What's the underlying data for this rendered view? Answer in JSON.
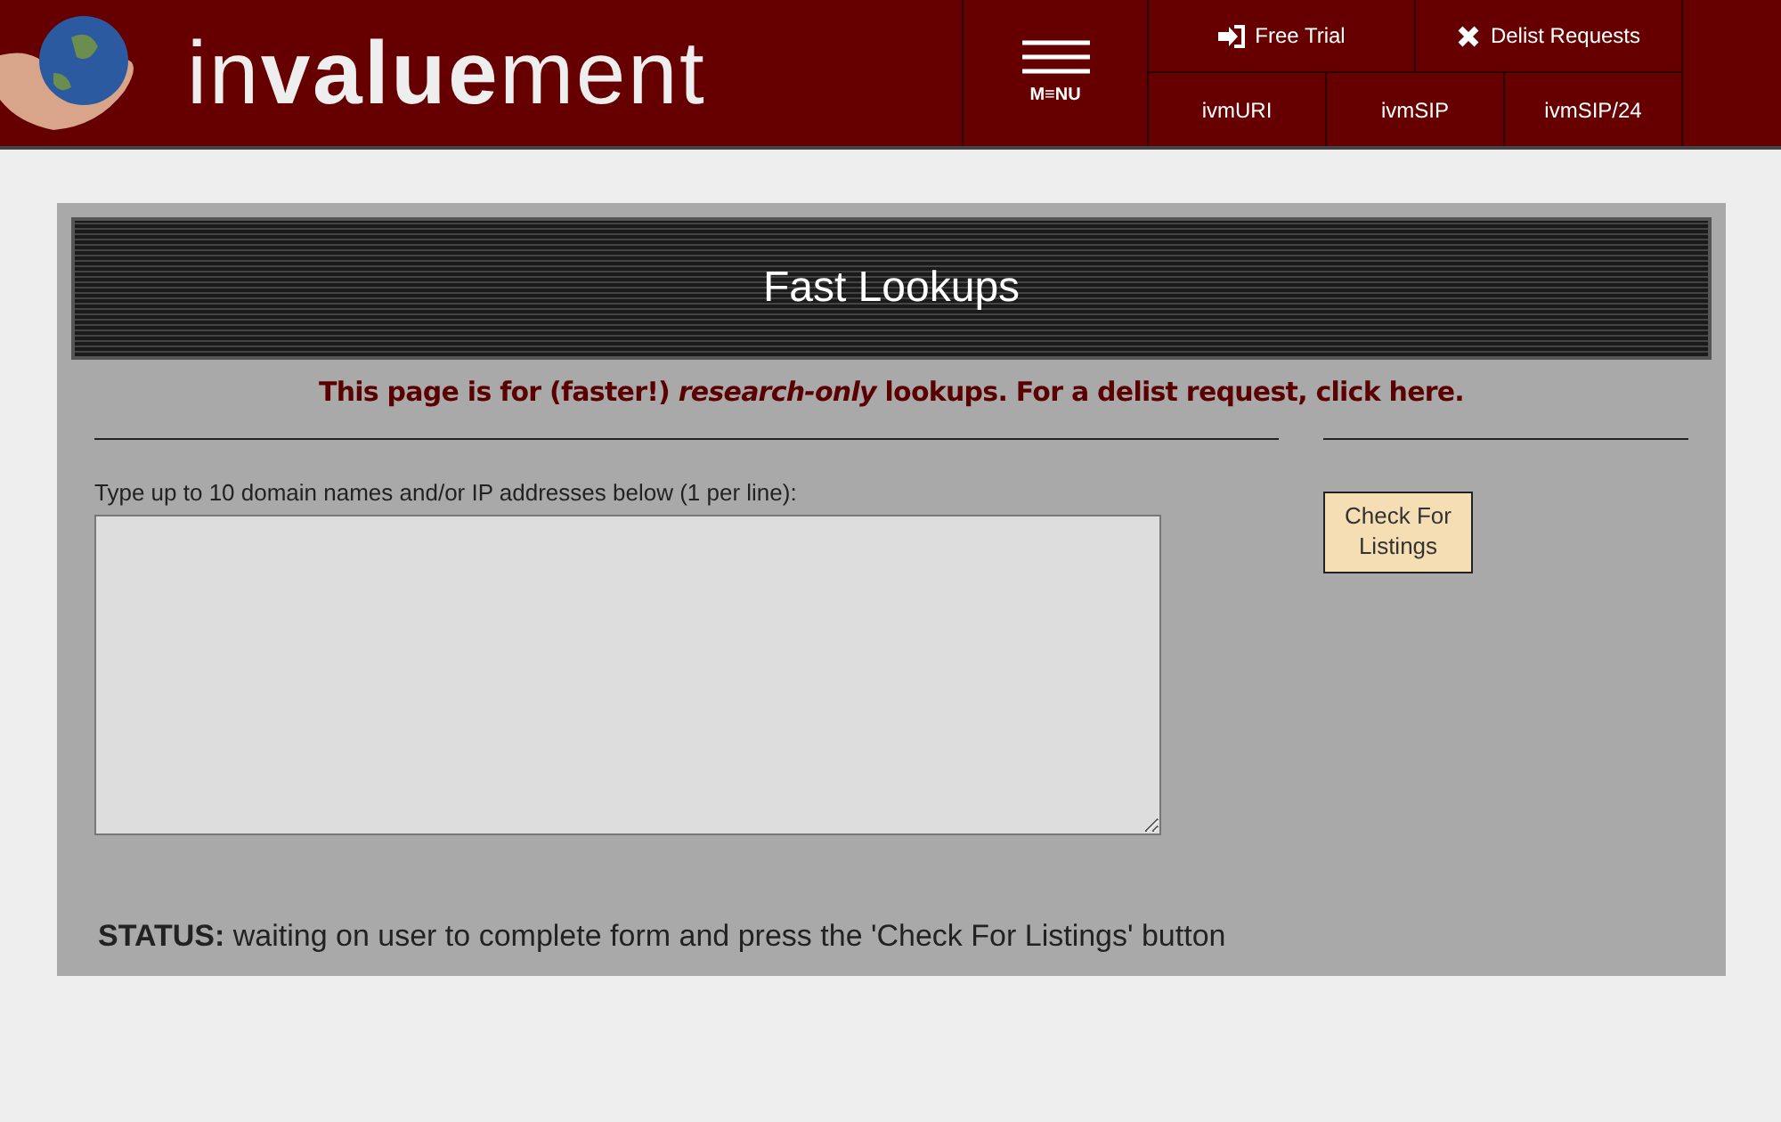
{
  "header": {
    "logo": "in**value**ment",
    "menu_label": "M≡NU",
    "top_links": [
      {
        "label": "Free Trial",
        "kind": "signin"
      },
      {
        "label": "Delist Requests",
        "kind": "close"
      }
    ],
    "bottom_links": [
      "ivmURI",
      "ivmSIP",
      "ivmSIP/24"
    ]
  },
  "panel": {
    "title": "Fast Lookups",
    "notice": "This page is for (faster!) *research-only* lookups. For a delist request,",
    "notice_link": "click here.",
    "field_label": "Type up to 10 domain names and/or IP addresses below (1 per line):",
    "button": "Check For Listings",
    "status_label": "STATUS:",
    "status_text": "waiting on user to complete form and press the 'Check For Listings' button"
  }
}
